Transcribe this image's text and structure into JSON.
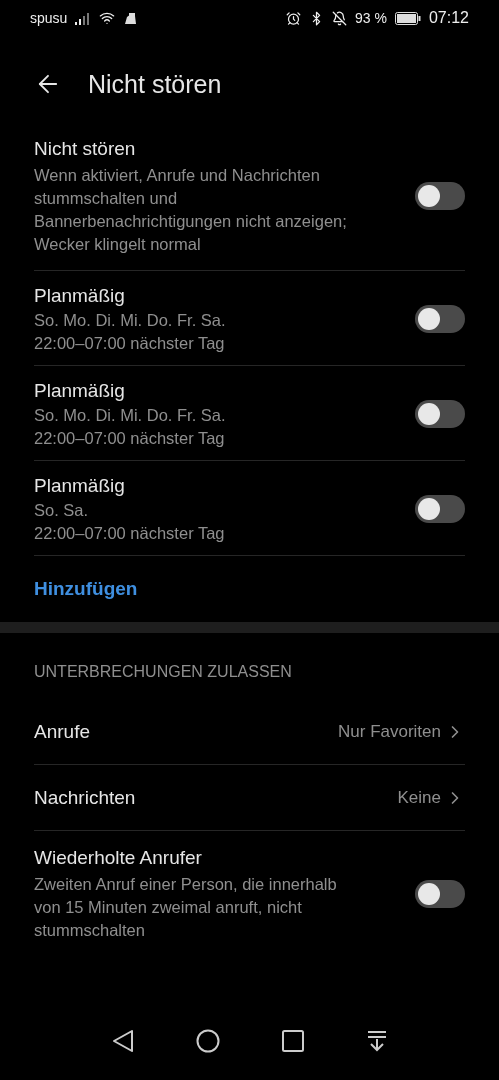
{
  "status_bar": {
    "carrier": "spusu",
    "battery_text": "93 %",
    "time": "07:12"
  },
  "header": {
    "title": "Nicht stören"
  },
  "main_toggle": {
    "title": "Nicht stören",
    "description": "Wenn aktiviert, Anrufe und Nachrichten stummschalten und Bannerbenachrichtigungen nicht anzeigen; Wecker klingelt normal",
    "on": false
  },
  "schedules": [
    {
      "title": "Planmäßig",
      "days": "So. Mo. Di. Mi. Do. Fr. Sa.",
      "time": "22:00–07:00 nächster Tag",
      "on": false
    },
    {
      "title": "Planmäßig",
      "days": "So. Mo. Di. Mi. Do. Fr. Sa.",
      "time": "22:00–07:00 nächster Tag",
      "on": false
    },
    {
      "title": "Planmäßig",
      "days": "So. Sa.",
      "time": "22:00–07:00 nächster Tag",
      "on": false
    }
  ],
  "add_link": "Hinzufügen",
  "section": {
    "heading": "UNTERBRECHUNGEN ZULASSEN",
    "items": [
      {
        "kind": "link",
        "title": "Anrufe",
        "value": "Nur Favoriten"
      },
      {
        "kind": "link",
        "title": "Nachrichten",
        "value": "Keine"
      },
      {
        "kind": "toggle",
        "title": "Wiederholte Anrufer",
        "description": "Zweiten Anruf einer Person, die innerhalb von 15 Minuten zweimal anruft, nicht stummschalten",
        "on": false
      }
    ]
  }
}
